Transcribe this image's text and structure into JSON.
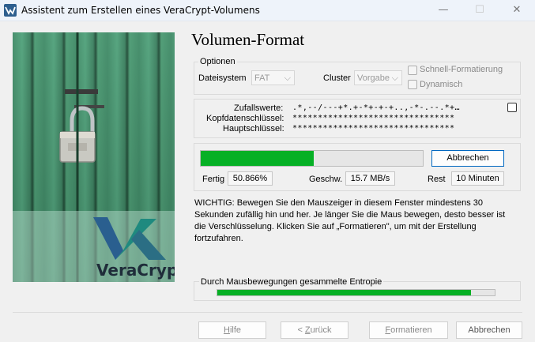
{
  "window": {
    "title": "Assistent zum Erstellen eines VeraCrypt-Volumens",
    "minimize": "—",
    "maximize": "☐",
    "close": "✕"
  },
  "logo_text": "VeraCrypt",
  "heading": "Volumen-Format",
  "options": {
    "legend": "Optionen",
    "filesystem_label": "Dateisystem",
    "filesystem_value": "FAT",
    "cluster_label": "Cluster",
    "cluster_value": "Vorgabe",
    "quick_format": "Schnell-Formatierung",
    "dynamic": "Dynamisch"
  },
  "keys": {
    "random_label": "Zufallswerte:",
    "random_value": ".*,--/---+*.+-*+-+-+..,-*-.--.*+…",
    "header_key_label": "Kopfdatenschlüssel:",
    "header_key_value": "********************************",
    "master_key_label": "Hauptschlüssel:",
    "master_key_value": "********************************"
  },
  "progress": {
    "percent_fraction": 0.50866,
    "abort_button": "Abbrechen",
    "done_label": "Fertig",
    "done_value": "50.866%",
    "speed_label": "Geschw.",
    "speed_value": "15.7 MB/s",
    "remaining_label": "Rest",
    "remaining_value": "10 Minuten"
  },
  "info_text": "WICHTIG: Bewegen Sie den Mauszeiger in diesem Fenster mindestens 30 Sekunden zufällig hin und her. Je länger Sie die Maus bewegen, desto besser ist die Verschlüsselung. Klicken Sie auf „Formatieren\", um mit der Erstellung fortzufahren.",
  "entropy": {
    "label": "Durch Mausbewegungen gesammelte Entropie",
    "fill_fraction": 0.915
  },
  "footer": {
    "help_prefix": "",
    "help_key": "H",
    "help_rest": "ilfe",
    "back_prefix": "< ",
    "back_key": "Z",
    "back_rest": "urück",
    "format_prefix": "",
    "format_key": "F",
    "format_rest": "ormatieren",
    "cancel": "Abbrechen"
  },
  "colors": {
    "progress_fill": "#06b025",
    "focus_border": "#0067c0",
    "titlebar": "#eef3fa"
  }
}
